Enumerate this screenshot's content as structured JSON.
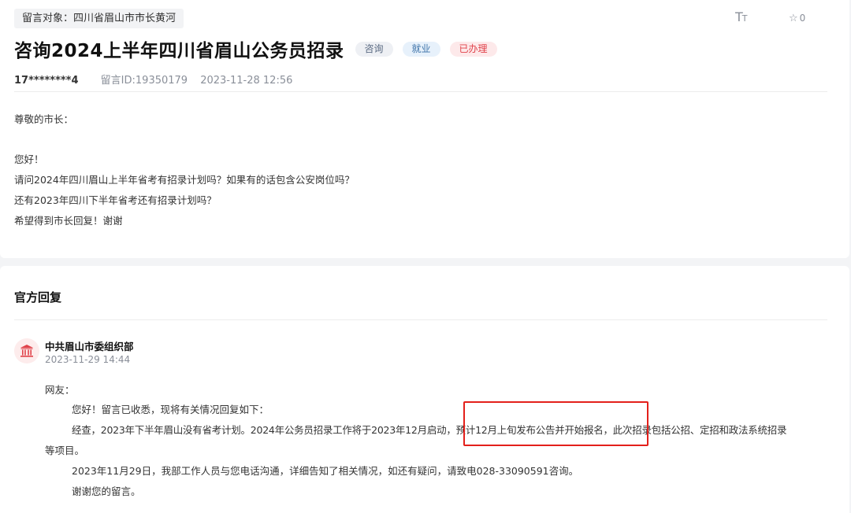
{
  "message": {
    "target": "留言对象：四川省眉山市市长黄河",
    "font_size_icon": "font-size-icon",
    "favorite_count": "0",
    "title": "咨询2024上半年四川省眉山公务员招录",
    "tags": [
      "咨询",
      "就业",
      "已办理"
    ],
    "author": "17********4",
    "message_id": "留言ID:19350179",
    "datetime": "2023-11-28 12:56",
    "body": [
      "尊敬的市长：",
      "您好！",
      "请问2024年四川眉山上半年省考有招录计划吗？如果有的话包含公安岗位吗？",
      "还有2023年四川下半年省考还有招录计划吗？",
      "希望得到市长回复！谢谢"
    ]
  },
  "reply": {
    "heading": "官方回复",
    "org_name": "中共眉山市委组织部",
    "datetime": "2023-11-29 14:44",
    "salutation": "网友：",
    "lines": [
      "您好！留言已收悉，现将有关情况回复如下：",
      "经查，2023年下半年眉山没有省考计划。2024年公务员招录工作将于2023年12月启动，预计12月上旬发布公告并开始报名，此次招录包括公招、定招和政法系统招录",
      "等项目。",
      "2023年11月29日，我部工作人员与您电话沟通，详细告知了相关情况，如还有疑问，请致电028-33090591咨询。",
      "谢谢您的留言。"
    ]
  },
  "colors": {
    "highlight": "#e3201b",
    "tag_done": "#e0424a",
    "tag_job": "#3d72a8"
  }
}
